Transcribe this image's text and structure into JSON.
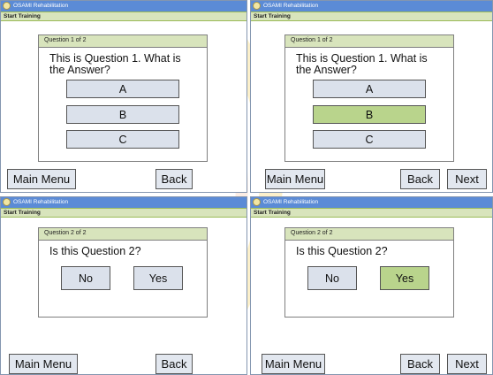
{
  "app_title": "OSAMI Rehabilitation",
  "header_label": "Start Training",
  "nav": {
    "main_menu": "Main Menu",
    "back": "Back",
    "next": "Next"
  },
  "screens": [
    {
      "question_header": "Question 1 of 2",
      "question_line1": "This is Question 1. What is",
      "question_line2": "the Answer?",
      "options": [
        "A",
        "B",
        "C"
      ],
      "selected": null
    },
    {
      "question_header": "Question 1 of 2",
      "question_line1": "This is Question 1. What is",
      "question_line2": "the Answer?",
      "options": [
        "A",
        "B",
        "C"
      ],
      "selected": "B"
    },
    {
      "question_header": "Question 2 of 2",
      "question_line1": "Is this Question 2?",
      "options": [
        "No",
        "Yes"
      ],
      "selected": null
    },
    {
      "question_header": "Question 2 of 2",
      "question_line1": "Is this Question 2?",
      "options": [
        "No",
        "Yes"
      ],
      "selected": "Yes"
    }
  ],
  "colors": {
    "title_bar": "#5b8bd6",
    "header_strip": "#d8e4bc",
    "button": "#dbe1eb",
    "selected": "#b9d48c",
    "watermark": "#f5c842"
  }
}
